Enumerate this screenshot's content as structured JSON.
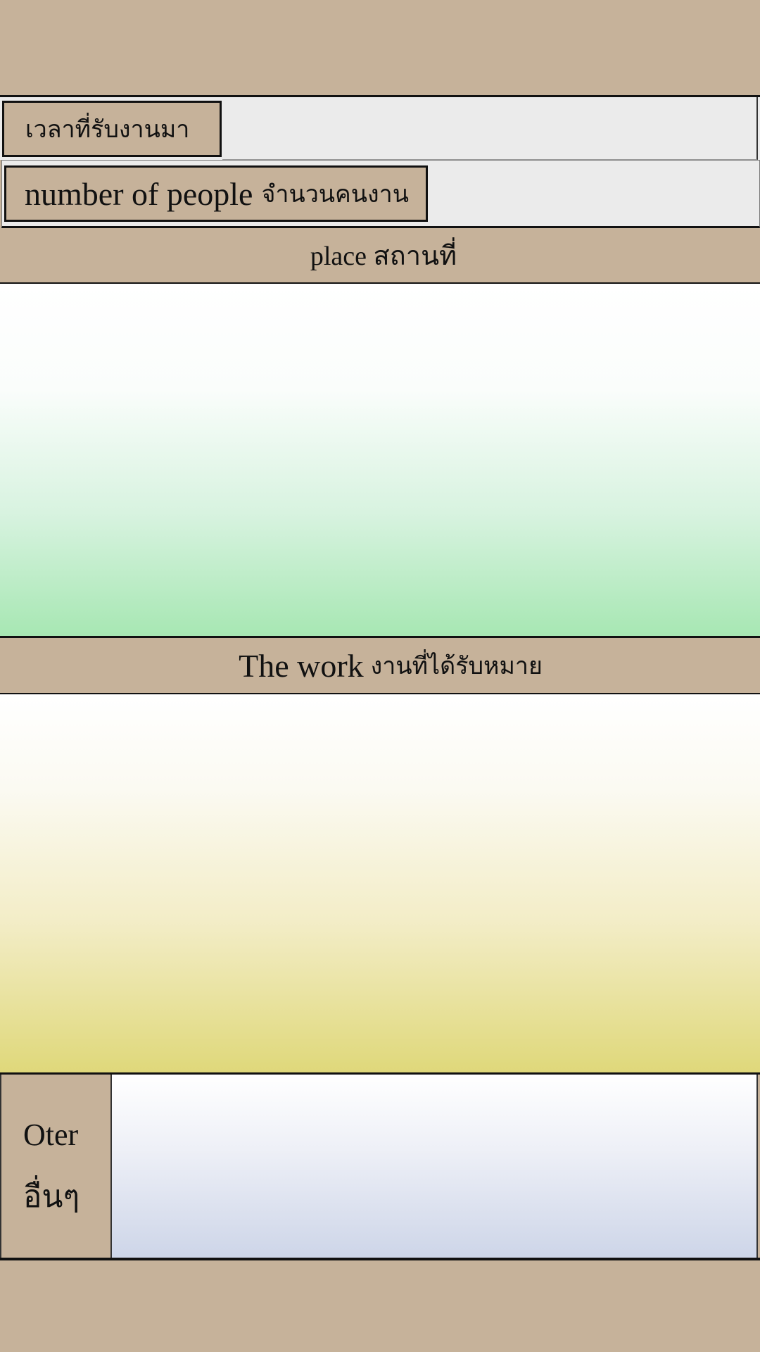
{
  "form": {
    "time_received": {
      "label": "เวลาที่รับงานมา"
    },
    "number_of_people": {
      "label_en": "number of people",
      "label_th": "จำนวนคนงาน"
    },
    "place": {
      "label": "place สถานที่"
    },
    "work": {
      "label_en": "The work",
      "label_th": "งานที่ได้รับหมาย"
    },
    "other": {
      "label_en": "Oter",
      "label_th": "อื่นๆ"
    }
  },
  "colors": {
    "background": "#c6b29a",
    "field": "#ebebeb",
    "place_gradient_end": "#a7e7b3",
    "work_gradient_end": "#dfd87a",
    "other_gradient_end": "#cdd5e8",
    "border": "#111111"
  }
}
